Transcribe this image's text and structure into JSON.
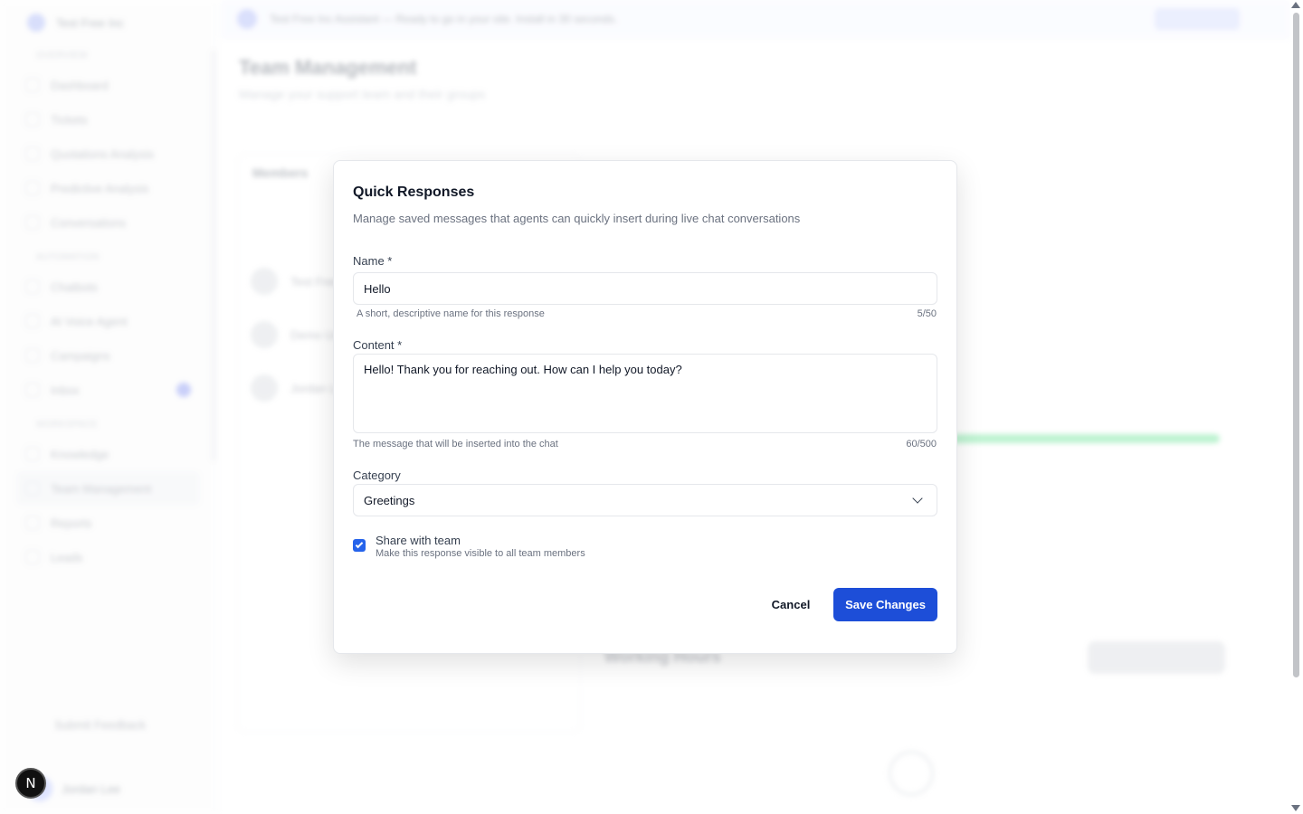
{
  "background": {
    "brand": "Test Free Inc",
    "banner_text": "Test Free Inc Assistant — Ready to go in your site. Install in 30 seconds.",
    "page_title": "Team Management",
    "page_subtitle": "Manage your support team and their groups",
    "members_title": "Members",
    "members": [
      "Test Free",
      "Demo User",
      "Jordan Lee"
    ],
    "working_hours_title": "Working Hours",
    "sidebar_items": [
      "Dashboard",
      "Tickets",
      "Quotations Analysis",
      "Predictive Analysis",
      "Conversations",
      "Chatbots",
      "AI Voice Agent",
      "Campaigns",
      "Inbox",
      "Knowledge",
      "Team Management",
      "Reports",
      "Leads"
    ],
    "feedback": "Submit Feedback",
    "user_name": "Jordan Lee"
  },
  "dialog": {
    "title": "Quick Responses",
    "description": "Manage saved messages that agents can quickly insert during live chat conversations",
    "name_label": "Name *",
    "name_value": "Hello",
    "name_hint": "A short, descriptive name for this response",
    "name_count": "5/50",
    "content_label": "Content *",
    "content_value": "Hello! Thank you for reaching out. How can I help you today?",
    "content_hint": "The message that will be inserted into the chat",
    "content_count": "60/500",
    "category_label": "Category",
    "category_value": "Greetings",
    "share_label": "Share with team",
    "share_desc": "Make this response visible to all team members",
    "share_checked": true,
    "cancel_label": "Cancel",
    "save_label": "Save Changes"
  },
  "dev_badge": "N",
  "colors": {
    "primary": "#1d4ed8",
    "checkbox": "#2563eb"
  }
}
